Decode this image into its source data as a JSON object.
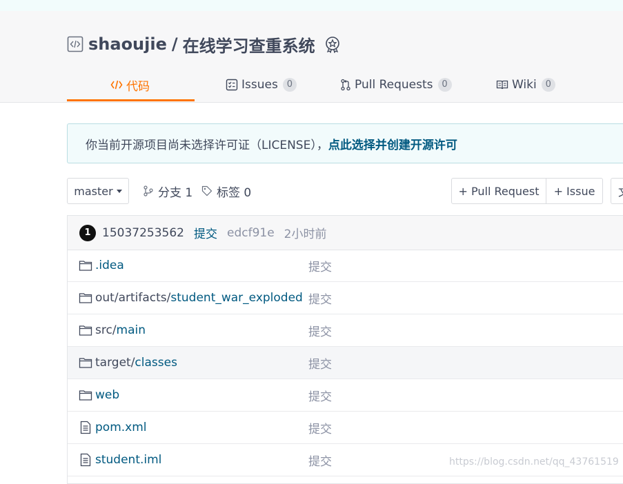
{
  "repo": {
    "owner": "shaoujie",
    "separator": "/",
    "name": "在线学习查重系统"
  },
  "tabs": [
    {
      "label": "代码",
      "icon": "code-icon"
    },
    {
      "label": "Issues",
      "count": "0",
      "icon": "issues-icon"
    },
    {
      "label": "Pull Requests",
      "count": "0",
      "icon": "pull-request-icon"
    },
    {
      "label": "Wiki",
      "count": "0",
      "icon": "wiki-icon"
    }
  ],
  "notice": {
    "text": "你当前开源项目尚未选择许可证（LICENSE），",
    "link": "点此选择并创建开源许可"
  },
  "toolbar": {
    "branch": "master",
    "branches_label": "分支 1",
    "tags_label": "标签 0",
    "pull_request_button": "+ Pull Request",
    "issue_button": "+ Issue",
    "extra_button": "文"
  },
  "commit": {
    "avatar": "1",
    "author": "15037253562",
    "message": "提交",
    "sha": "edcf91e",
    "time": "2小时前"
  },
  "files": [
    {
      "type": "folder",
      "prefix": "",
      "name": ".idea",
      "message": "提交"
    },
    {
      "type": "folder",
      "prefix": "out/artifacts/",
      "name": "student_war_exploded",
      "message": "提交"
    },
    {
      "type": "folder",
      "prefix": "src/",
      "name": "main",
      "message": "提交"
    },
    {
      "type": "folder",
      "prefix": "target/",
      "name": "classes",
      "message": "提交"
    },
    {
      "type": "folder",
      "prefix": "",
      "name": "web",
      "message": "提交"
    },
    {
      "type": "file",
      "prefix": "",
      "name": "pom.xml",
      "message": "提交"
    },
    {
      "type": "file",
      "prefix": "",
      "name": "student.iml",
      "message": "提交"
    }
  ],
  "watermark": "https://blog.csdn.net/qq_43761519",
  "colors": {
    "accent": "#fe7300",
    "link": "#005980",
    "text": "#40485b",
    "muted": "#8c92a4"
  }
}
